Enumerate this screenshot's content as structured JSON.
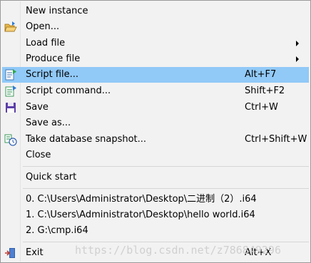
{
  "menu": {
    "items": [
      {
        "label": "New instance",
        "shortcut": "",
        "icon": null,
        "submenu": false,
        "highlighted": false
      },
      {
        "label": "Open...",
        "shortcut": "",
        "icon": "open-folder-icon",
        "submenu": false,
        "highlighted": false
      },
      {
        "label": "Load file",
        "shortcut": "",
        "icon": null,
        "submenu": true,
        "highlighted": false
      },
      {
        "label": "Produce file",
        "shortcut": "",
        "icon": null,
        "submenu": true,
        "highlighted": false
      },
      {
        "label": "Script file...",
        "shortcut": "Alt+F7",
        "icon": "script-file-icon",
        "submenu": false,
        "highlighted": true
      },
      {
        "label": "Script command...",
        "shortcut": "Shift+F2",
        "icon": "script-command-icon",
        "submenu": false,
        "highlighted": false
      },
      {
        "label": "Save",
        "shortcut": "Ctrl+W",
        "icon": "floppy-disk-icon",
        "submenu": false,
        "highlighted": false
      },
      {
        "label": "Save as...",
        "shortcut": "",
        "icon": null,
        "submenu": false,
        "highlighted": false
      },
      {
        "label": "Take database snapshot...",
        "shortcut": "Ctrl+Shift+W",
        "icon": "snapshot-icon",
        "submenu": false,
        "highlighted": false
      },
      {
        "label": "Close",
        "shortcut": "",
        "icon": null,
        "submenu": false,
        "highlighted": false
      },
      {
        "label": "Quick start",
        "shortcut": "",
        "icon": null,
        "submenu": false,
        "highlighted": false
      },
      {
        "label": "0. C:\\Users\\Administrator\\Desktop\\二进制（2）.i64",
        "shortcut": "",
        "icon": null,
        "submenu": false,
        "highlighted": false
      },
      {
        "label": "1. C:\\Users\\Administrator\\Desktop\\hello world.i64",
        "shortcut": "",
        "icon": null,
        "submenu": false,
        "highlighted": false
      },
      {
        "label": "2. G:\\cmp.i64",
        "shortcut": "",
        "icon": null,
        "submenu": false,
        "highlighted": false
      },
      {
        "label": "Exit",
        "shortcut": "Alt+X",
        "icon": "exit-door-icon",
        "submenu": false,
        "highlighted": false
      }
    ]
  },
  "watermark": "https://blog.csdn.net/z786849296",
  "colors": {
    "menu_bg": "#f2f2f2",
    "highlight": "#91c9f7",
    "separator": "#d6d6d6"
  }
}
